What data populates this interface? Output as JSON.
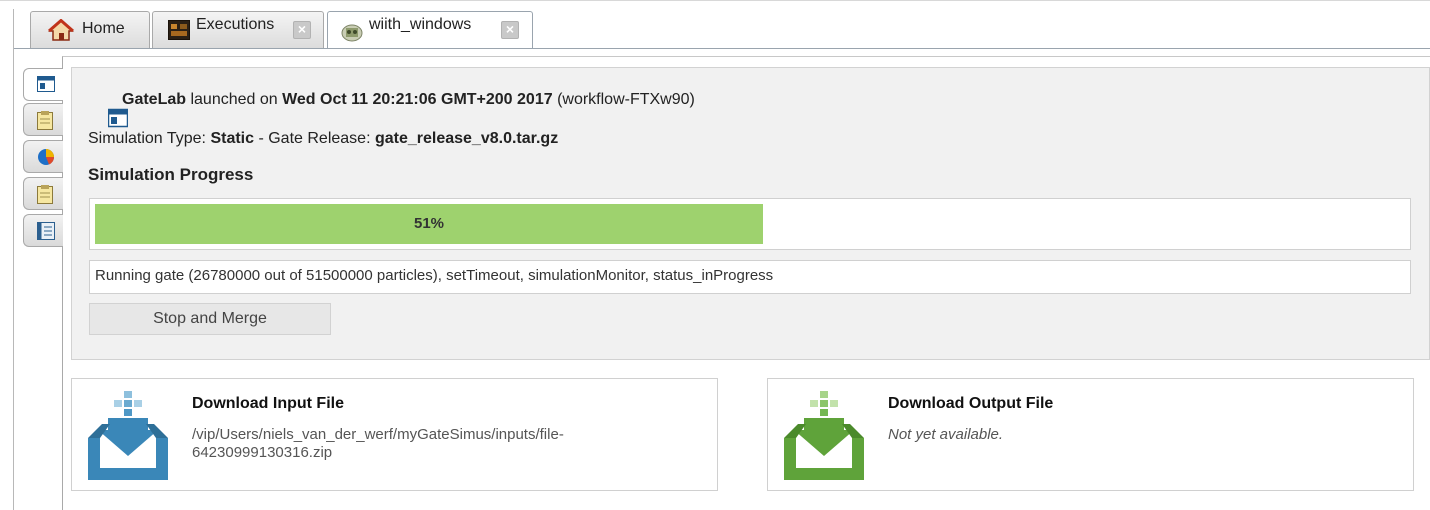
{
  "tabs": [
    {
      "label": "Home",
      "icon": "home-icon",
      "closable": false
    },
    {
      "label": "Executions",
      "icon": "executions-icon",
      "closable": true
    },
    {
      "label": "wiith_windows",
      "icon": "workflow-icon",
      "closable": true,
      "active": true
    }
  ],
  "side_buttons": [
    "summary-icon",
    "clipboard-icon",
    "pie-chart-icon",
    "clipboard-icon",
    "console-icon"
  ],
  "header": {
    "app_name": "GateLab",
    "launched_text": " launched on ",
    "date": "Wed Oct 11 20:21:06 GMT+200 2017",
    "workflow": " (workflow-FTXw90)"
  },
  "sim_info": {
    "type_label": "Simulation Type: ",
    "type_value": "Static",
    "release_label": " - Gate Release: ",
    "release_value": "gate_release_v8.0.tar.gz"
  },
  "progress": {
    "heading": "Simulation Progress",
    "fraction": 0.51,
    "label": "51%",
    "status": "Running gate (26780000 out of 51500000 particles), setTimeout, simulationMonitor, status_inProgress",
    "button_label": "Stop and Merge"
  },
  "downloads": {
    "input": {
      "title": "Download Input File",
      "path_line1": "/vip/Users/niels_van_der_werf/myGateSimus/inputs/file-",
      "path_line2": "64230999130316.zip",
      "color": "#3a87b8"
    },
    "output": {
      "title": "Download Output File",
      "status": "Not yet available.",
      "color": "#5fa33a"
    }
  },
  "colors": {
    "progress_fill": "#9ed26e",
    "panel_bg": "#f1f1f1"
  }
}
